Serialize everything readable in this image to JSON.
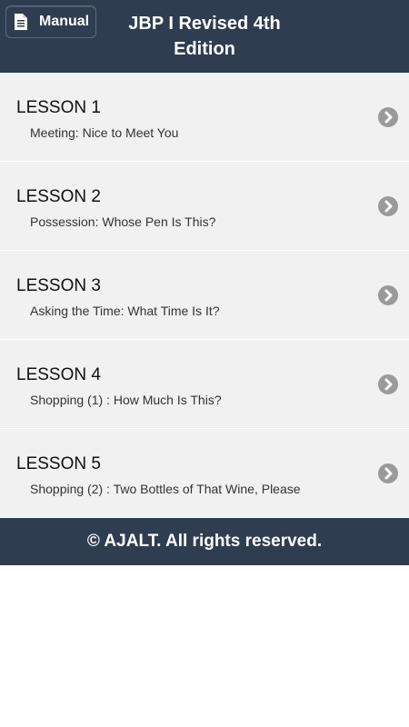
{
  "header": {
    "manual_label": "Manual",
    "title_line1": "JBP I  Revised 4th",
    "title_line2": "Edition"
  },
  "lessons": [
    {
      "number": "LESSON 1",
      "title": "Meeting: Nice to Meet You"
    },
    {
      "number": "LESSON 2",
      "title": "Possession: Whose Pen Is This?"
    },
    {
      "number": "LESSON 3",
      "title": "Asking the Time: What Time Is It?"
    },
    {
      "number": "LESSON 4",
      "title": "Shopping (1) : How Much Is This?"
    },
    {
      "number": "LESSON 5",
      "title": "Shopping (2) : Two Bottles of That Wine, Please"
    }
  ],
  "footer": {
    "copyright": "© AJALT. All rights reserved."
  },
  "colors": {
    "bar": "#2e3d4f",
    "row": "#f1f1f1",
    "chevron": "#9a9a9a"
  },
  "icons": {
    "manual": "document-icon",
    "row": "chevron-right-circle-icon"
  }
}
